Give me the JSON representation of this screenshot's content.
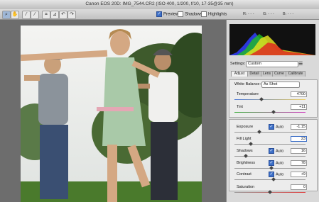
{
  "window": {
    "title": "Canon EOS 20D:  IMG_7544.CR2  (ISO 400, 1/200, f/10, 17-35@35 mm)"
  },
  "toolbar": {
    "tools": [
      "zoom-tool",
      "hand-tool",
      "white-balance-tool",
      "color-sampler-tool",
      "crop-tool",
      "straighten-tool",
      "rotate-left-tool",
      "rotate-right-tool"
    ],
    "tool_glyphs": [
      "⌕",
      "✋",
      "⁄",
      "⁄",
      "⌗",
      "⊿",
      "↶",
      "↷"
    ],
    "preview_label": "Preview",
    "shadows_label": "Shadows",
    "highlights_label": "Highlights",
    "r_label": "R:  - - -",
    "g_label": "G:  - - -",
    "b_label": "B:  - - -"
  },
  "panel": {
    "settings_label": "Settings:",
    "settings_value": "Custom",
    "tabs": [
      "Adjust",
      "Detail",
      "Lens",
      "Curve",
      "Calibrate"
    ],
    "white_balance_label": "White Balance:",
    "white_balance_value": "As Shot",
    "temperature_label": "Temperature",
    "temperature_value": "4700",
    "tint_label": "Tint",
    "tint_value": "+11",
    "auto_label": "Auto",
    "exposure_label": "Exposure",
    "exposure_value": "-1.15",
    "fill_light_label": "Fill Light",
    "fill_light_value": "23",
    "shadows_label": "Shadows",
    "shadows_value": "16",
    "brightness_label": "Brightness",
    "brightness_value": "78",
    "contrast_label": "Contrast",
    "contrast_value": "+9",
    "saturation_label": "Saturation",
    "saturation_value": "0"
  },
  "sliders": {
    "temperature": 0.38,
    "tint": 0.55,
    "exposure": 0.35,
    "fill_light": 0.23,
    "shadows": 0.16,
    "brightness": 0.52,
    "contrast": 0.55,
    "saturation": 0.5
  },
  "colors": {
    "accent": "#3c6fc7",
    "histogram_bg": "#111111"
  }
}
